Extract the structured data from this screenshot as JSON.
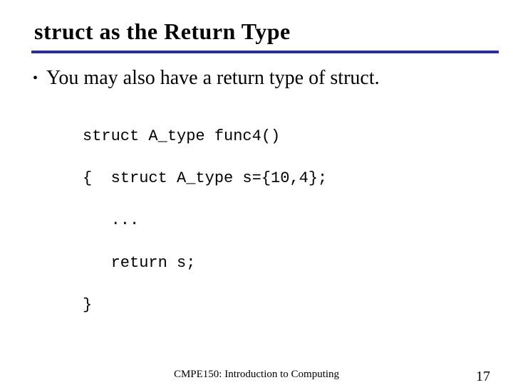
{
  "title": "struct as the Return Type",
  "bullet": "You may also have a return type of struct.",
  "code": {
    "l1": "struct A_type func4()",
    "l2": "{  struct A_type s={10,4};",
    "l3": "   ...",
    "l4": "   return s;",
    "l5": "}"
  },
  "footer": {
    "center": "CMPE150: Introduction to Computing",
    "page": "17"
  }
}
